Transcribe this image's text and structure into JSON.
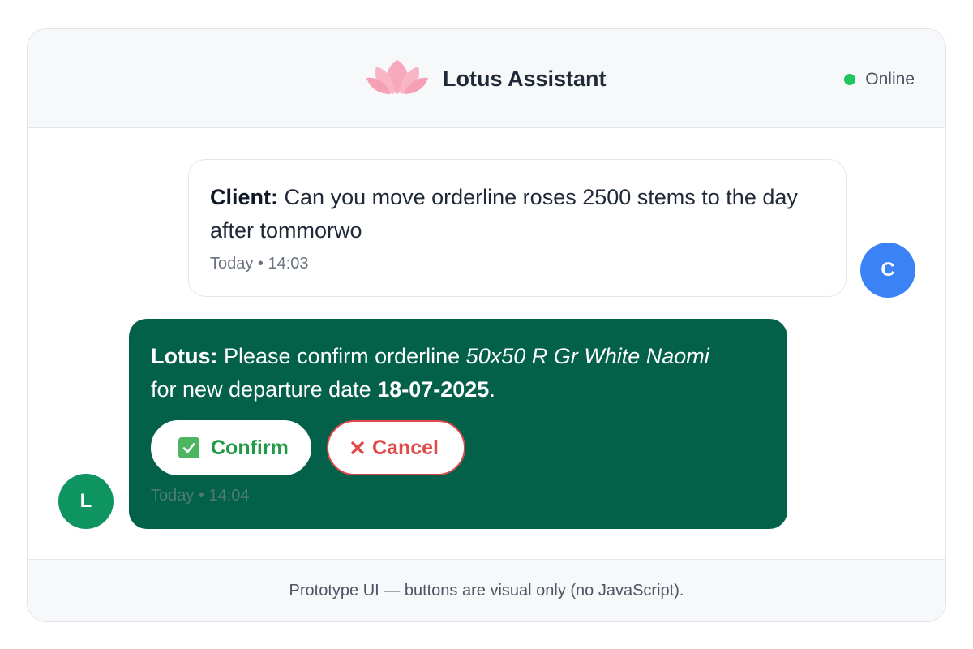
{
  "header": {
    "logo_icon": "lotus-icon",
    "title": "Lotus Assistant",
    "status": "Online",
    "status_color": "#22c55e"
  },
  "messages": [
    {
      "sender": "Client",
      "avatar": "C",
      "avatar_color": "#3b82f6",
      "text": "Can you move orderline roses 2500 stems to the day after tommorwo",
      "time": "Today • 14:03"
    },
    {
      "sender": "Lotus",
      "avatar": "L",
      "avatar_color": "#0e9460",
      "text_prefix": "Please confirm orderline",
      "orderline": "50x50 R Gr White Naomi",
      "text_middle": "for new departure date",
      "date": "18-07-2025",
      "text_suffix": ".",
      "time": "Today • 14:04",
      "actions": {
        "confirm_label": "Confirm",
        "confirm_icon": "check-box-icon",
        "cancel_label": "Cancel",
        "cancel_icon": "x-icon"
      }
    }
  ],
  "footer": {
    "note": "Prototype UI — buttons are visual only (no JavaScript)."
  },
  "colors": {
    "bot_bubble": "#046149",
    "confirm": "#1f9a45",
    "cancel": "#e0484a"
  }
}
